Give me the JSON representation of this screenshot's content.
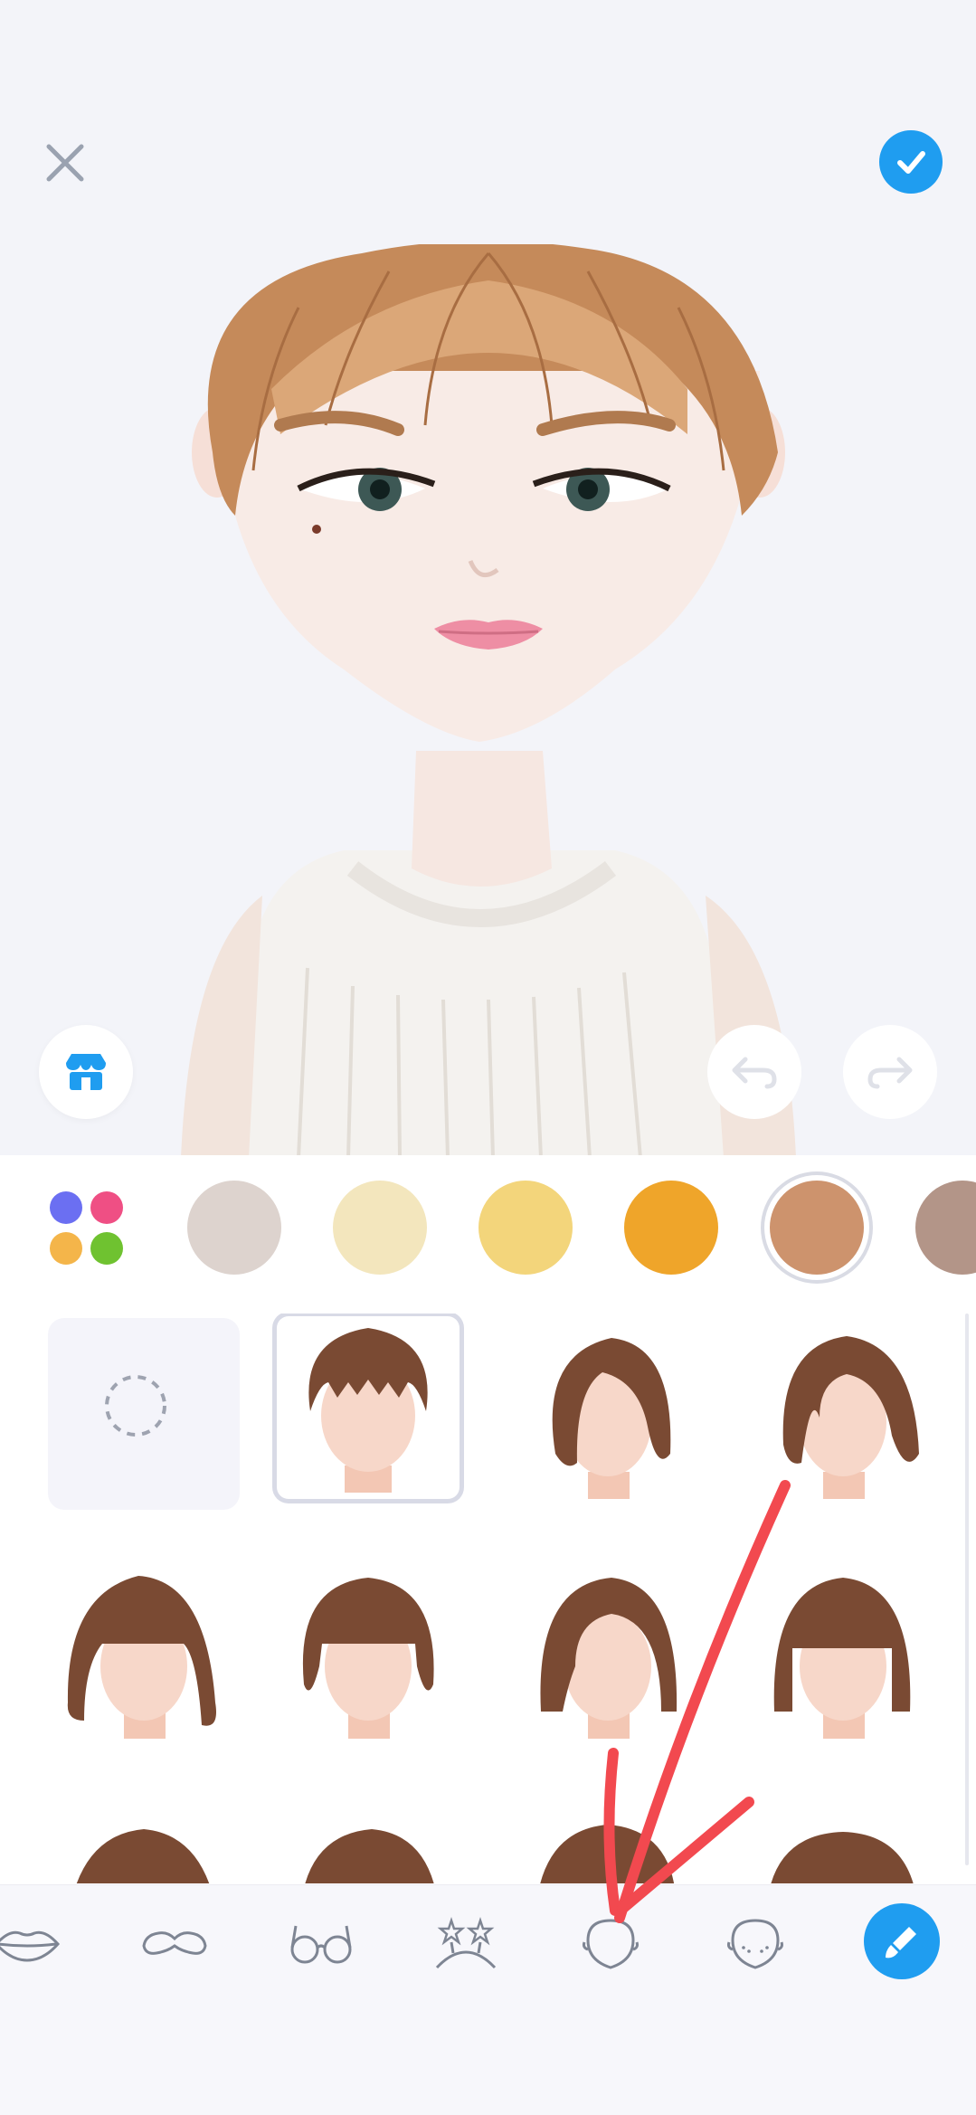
{
  "header": {
    "close_icon": "close-icon",
    "confirm_icon": "check-icon"
  },
  "preview": {
    "store_icon": "store-icon",
    "undo_icon": "undo-icon",
    "redo_icon": "redo-icon"
  },
  "colors": {
    "palette_icon": "color-palette-icon",
    "swatches": [
      "#ddd3ce",
      "#f3e6bd",
      "#f3d57b",
      "#efa52a",
      "#cd936d",
      "#b39588"
    ],
    "selected_index": 4,
    "accent": "#1f9df0"
  },
  "hairstyles": {
    "selected_index": 1,
    "items": [
      "none",
      "short-bob-bangs",
      "side-part-wavy",
      "side-part-wavy-long",
      "ponytail-bangs",
      "short-bangs",
      "bob-side-part",
      "bob-blunt-bangs",
      "partial-1",
      "partial-2",
      "partial-3",
      "partial-4"
    ]
  },
  "toolbar": {
    "items": [
      "lips-icon",
      "mustache-icon",
      "glasses-icon",
      "headband-icon",
      "face-shape-icon",
      "face-freckles-icon",
      "paint-brush-icon"
    ],
    "active_index": 6
  }
}
